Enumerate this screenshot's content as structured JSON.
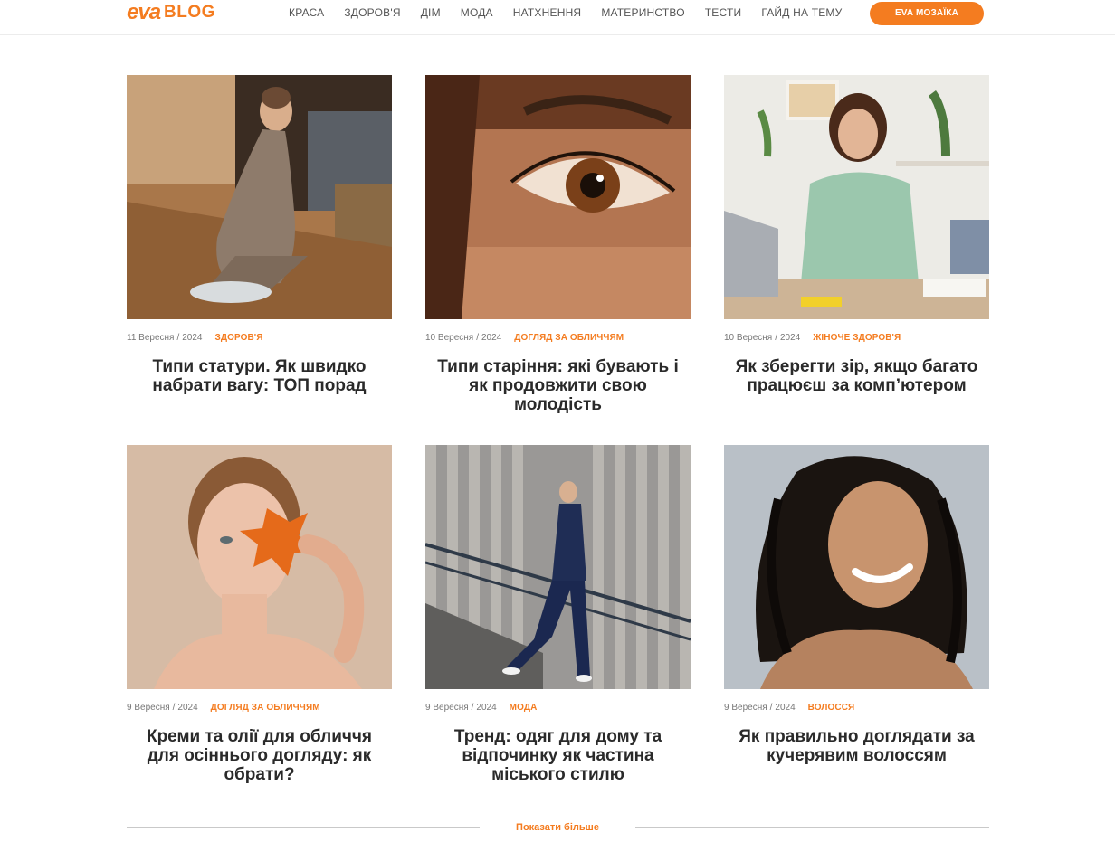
{
  "header": {
    "logo_brand": "eva",
    "logo_suffix": "BLOG",
    "nav": [
      {
        "label": "КРАСА"
      },
      {
        "label": "ЗДОРОВ'Я"
      },
      {
        "label": "ДІМ"
      },
      {
        "label": "МОДА"
      },
      {
        "label": "НАТХНЕННЯ"
      },
      {
        "label": "МАТЕРИНСТВО"
      },
      {
        "label": "ТЕСТИ"
      },
      {
        "label": "ГАЙД НА ТЕМУ"
      }
    ],
    "cta_label": "EVA МОЗАЇКА"
  },
  "articles": [
    {
      "date": "11 Вересня",
      "year": "2024",
      "category": "ЗДОРОВ'Я",
      "title": "Типи статури. Як швидко набрати вагу: ТОП порад",
      "image": "woman-on-scale-photo"
    },
    {
      "date": "10 Вересня",
      "year": "2024",
      "category": "ДОГЛЯД ЗА ОБЛИЧЧЯМ",
      "title": "Типи старіння: які бувають і як продовжити свою молодість",
      "image": "eye-closeup-photo"
    },
    {
      "date": "10 Вересня",
      "year": "2024",
      "category": "ЖІНОЧЕ ЗДОРОВ'Я",
      "title": "Як зберегти зір, якщо багато працюєш за комп’ютером",
      "image": "woman-at-desk-photo"
    },
    {
      "date": "9 Вересня",
      "year": "2024",
      "category": "ДОГЛЯД ЗА ОБЛИЧЧЯМ",
      "title": "Креми та олії для обличчя для осіннього догляду: як обрати?",
      "image": "woman-with-leaf-photo"
    },
    {
      "date": "9 Вересня",
      "year": "2024",
      "category": "МОДА",
      "title": "Тренд: одяг для дому та відпочинку як частина міського стилю",
      "image": "woman-on-stairs-photo"
    },
    {
      "date": "9 Вересня",
      "year": "2024",
      "category": "ВОЛОССЯ",
      "title": "Як правильно доглядати за кучерявим волоссям",
      "image": "curly-hair-woman-photo"
    }
  ],
  "load_more_label": "Показати більше",
  "colors": {
    "accent": "#f47c20",
    "logo_green": "#6cc04a"
  }
}
